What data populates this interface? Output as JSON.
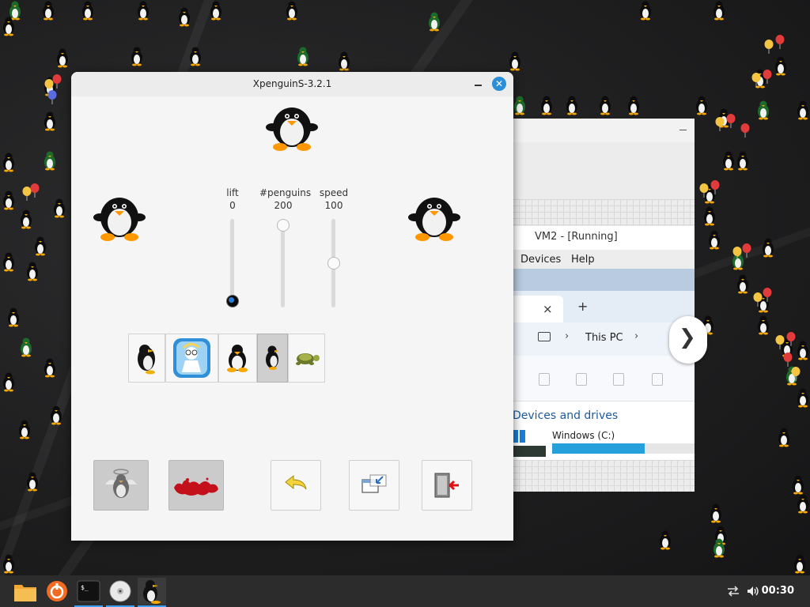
{
  "dialog": {
    "title": "XpenguinS-3.2.1",
    "sliders": [
      {
        "name": "lift",
        "value": "0",
        "level": 0.0
      },
      {
        "name": "#penguins",
        "value": "200",
        "level": 1.0
      },
      {
        "name": "speed",
        "value": "100",
        "level": 0.5
      }
    ],
    "themes": [
      {
        "id": "penguins",
        "icon": "penguin-theme-icon",
        "selected": false
      },
      {
        "id": "big-penguins",
        "icon": "professor-theme-icon",
        "selected": false
      },
      {
        "id": "tux",
        "icon": "tux-theme-icon",
        "selected": false
      },
      {
        "id": "classic",
        "icon": "small-penguin-theme-icon",
        "selected": true
      },
      {
        "id": "turtles",
        "icon": "turtle-theme-icon",
        "selected": false
      }
    ],
    "actions": [
      {
        "id": "god-mode",
        "icon": "angel-penguin-icon"
      },
      {
        "id": "splat",
        "icon": "blood-splat-icon"
      },
      {
        "id": "undo",
        "icon": "undo-arrow-icon"
      },
      {
        "id": "window",
        "icon": "window-icon"
      },
      {
        "id": "exit",
        "icon": "exit-door-icon"
      }
    ]
  },
  "background_window": {
    "title": "VM2 - [Running]",
    "menu": [
      "Devices",
      "Help"
    ],
    "tab_close": "×",
    "tab_add": "+",
    "breadcrumb": "This PC",
    "section_title": "Devices and drives",
    "drive_label": "Windows (C:)",
    "drive_usage": 0.65
  },
  "taskbar": {
    "items": [
      "file-manager-icon",
      "software-center-icon",
      "terminal-icon",
      "disc-icon",
      "xpenguins-icon"
    ],
    "terminal_glyph": "$_",
    "clock": "00:30"
  },
  "colors": {
    "accent": "#3d9ff2",
    "close_button": "#2a8fd6",
    "drive_fill": "#26a0da",
    "taskbar": "#2c2c2c"
  }
}
